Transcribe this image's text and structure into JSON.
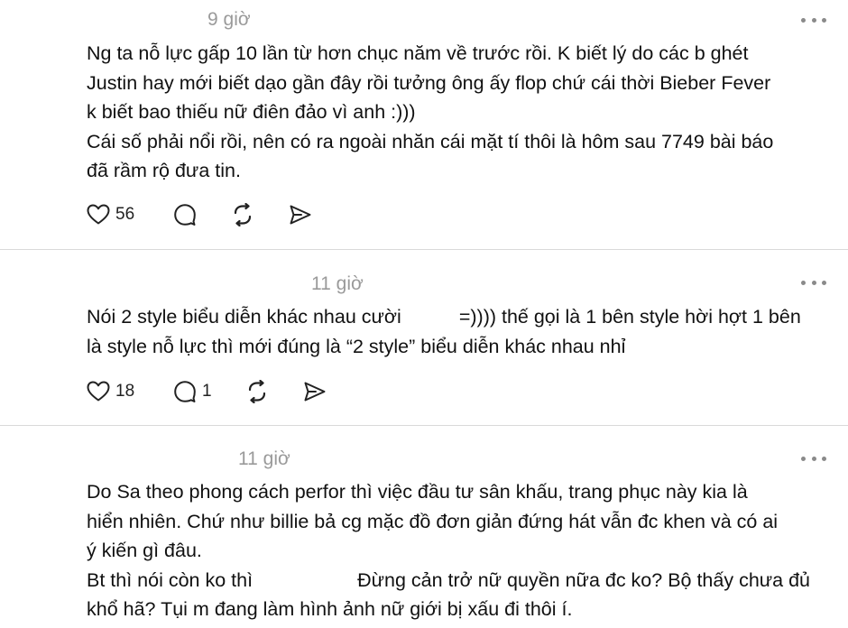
{
  "posts": [
    {
      "time": "9 giờ",
      "lines": [
        "Ng ta nỗ lực gấp 10 lần từ hơn chục năm về trước rồi. K biết lý do các b ghét",
        "Justin hay mới biết dạo gần đây rồi tưởng ông ấy flop chứ cái thời Bieber Fever",
        "k biết bao thiếu nữ điên đảo vì anh :)))",
        "Cái số phải nổi rồi, nên có ra ngoài nhăn cái mặt tí thôi là hôm sau 7749 bài báo",
        "đã rầm rộ đưa tin."
      ],
      "likes": "56",
      "replies": ""
    },
    {
      "time": "11 giờ",
      "line1_before": "Nói 2 style biểu diễn khác nhau cười",
      "line1_after": "=)))) thế gọi là 1 bên style hời hợt 1 bên",
      "line2": "là style nỗ lực thì mới đúng là “2 style” biểu diễn khác nhau nhỉ",
      "likes": "18",
      "replies": "1"
    },
    {
      "time": "11 giờ",
      "lines": [
        "Do Sa theo phong cách perfor thì việc đầu tư sân khấu, trang phục này kia là",
        "hiển nhiên. Chứ như billie bả cg mặc đồ đơn giản đứng hát vẫn đc khen và có ai",
        "ý kiến gì đâu."
      ],
      "line4_before": "Bt thì nói còn ko thì",
      "line4_after": "Đừng cản trở nữ quyền nữa đc ko? Bộ thấy chưa đủ",
      "line5": "khổ hã? Tụi m đang làm hình ảnh nữ giới bị xấu đi thôi í."
    }
  ],
  "icons": {
    "like": "heart-icon",
    "reply": "comment-bubble-icon",
    "repost": "repost-arrows-icon",
    "share": "send-icon",
    "more": "more-dots-icon"
  },
  "colors": {
    "text": "#111111",
    "muted": "#9a9a9a",
    "divider": "#d9d9d9",
    "icon": "#222222"
  }
}
